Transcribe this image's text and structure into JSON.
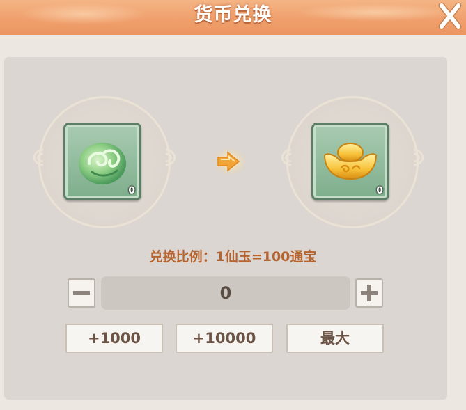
{
  "title": "货币兑换",
  "exchange": {
    "from": {
      "count": "0",
      "icon": "jade-cloud-icon"
    },
    "to": {
      "count": "0",
      "icon": "gold-ingot-icon"
    },
    "arrow_icon": "arrow-right-icon",
    "ratio_text": "兑换比例：1仙玉=100通宝"
  },
  "quantity": {
    "value": "0"
  },
  "quick_buttons": [
    "+1000",
    "+10000",
    "最大"
  ],
  "colors": {
    "title_bar": "#f0a06d",
    "panel": "#dbd6d1",
    "ratio_text": "#b5632f",
    "item_slot": "#7eae8c"
  }
}
